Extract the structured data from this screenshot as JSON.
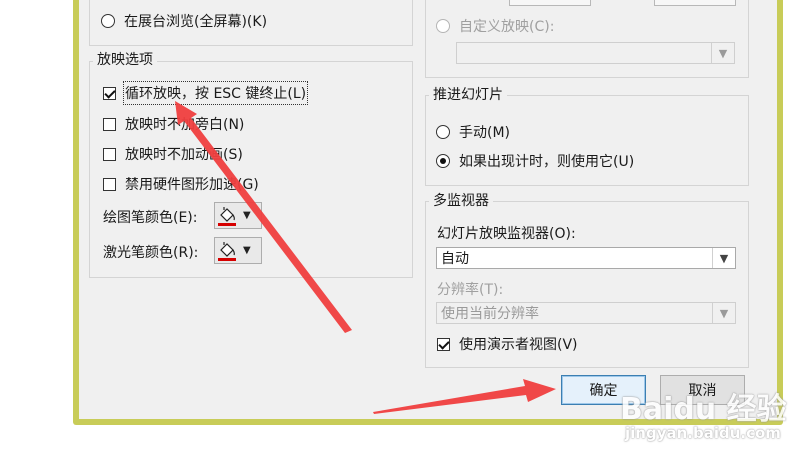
{
  "show_type": {
    "kiosk_label": "在展台浏览(全屏幕)(K)",
    "custom_show_label": "自定义放映(C):",
    "custom_show_value": ""
  },
  "options": {
    "title": "放映选项",
    "loop_label": "循环放映，按 ESC 键终止(L)",
    "no_narration_label": "放映时不加旁白(N)",
    "no_animation_label": "放映时不加动画(S)",
    "disable_hw_label": "禁用硬件图形加速(G)",
    "pen_color_label": "绘图笔颜色(E):",
    "laser_color_label": "激光笔颜色(R):"
  },
  "advance": {
    "title": "推进幻灯片",
    "manual_label": "手动(M)",
    "timings_label": "如果出现计时，则使用它(U)"
  },
  "monitors": {
    "title": "多监视器",
    "monitor_label": "幻灯片放映监视器(O):",
    "monitor_value": "自动",
    "resolution_label": "分辨率(T):",
    "resolution_value": "使用当前分辨率",
    "presenter_view_label": "使用演示者视图(V)"
  },
  "buttons": {
    "ok": "确定",
    "cancel": "取消"
  },
  "watermark": {
    "brand": "Baidu 经验",
    "url": "jingyan.baidu.com"
  },
  "colors": {
    "frame": "#c8cc58",
    "arrow": "#ef3e3e",
    "pen_red": "#d60000"
  }
}
